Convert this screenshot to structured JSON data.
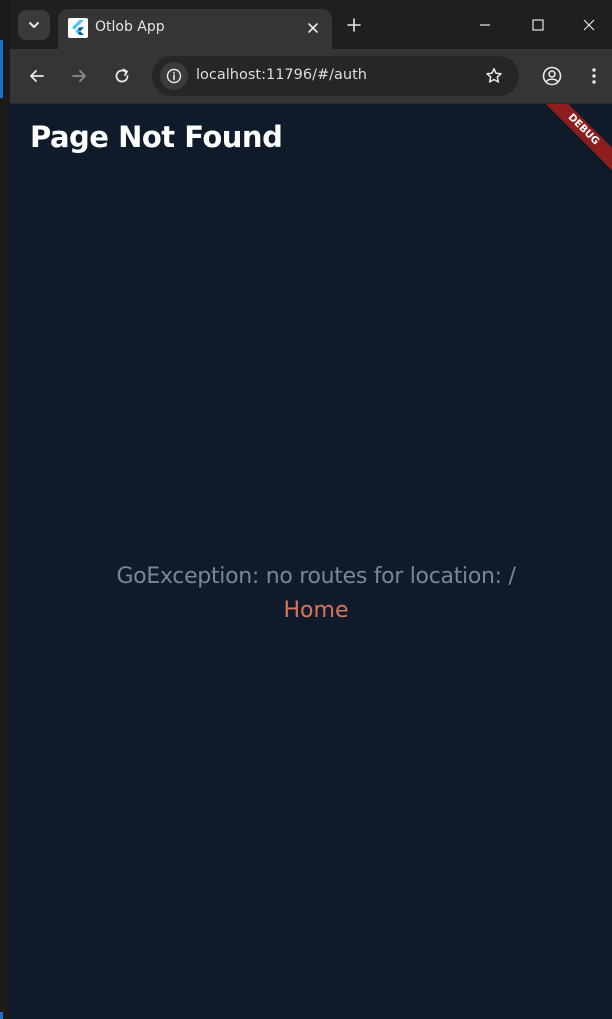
{
  "browser": {
    "tab": {
      "title": "Otlob App",
      "favicon": "flutter-icon"
    },
    "address_bar": {
      "url": "localhost:11796/#/auth"
    },
    "icons": {
      "tab_menu": "chevron-down-icon",
      "tab_close": "close-icon",
      "new_tab": "plus-icon",
      "minimize": "minimize-icon",
      "maximize": "maximize-icon",
      "close_window": "close-icon",
      "back": "arrow-left-icon",
      "forward": "arrow-right-icon",
      "reload": "reload-icon",
      "site_info": "info-icon",
      "bookmark": "star-icon",
      "profile": "profile-icon",
      "menu": "more-vertical-icon"
    }
  },
  "app": {
    "title": "Page Not Found",
    "error_message": "GoException: no routes for location: /",
    "home_link": "Home",
    "debug_banner": "DEBUG"
  },
  "colors": {
    "background": "#0f1b2a",
    "error_text": "#7d8590",
    "link": "#d9745a",
    "debug_banner": "#8e1d1d"
  }
}
